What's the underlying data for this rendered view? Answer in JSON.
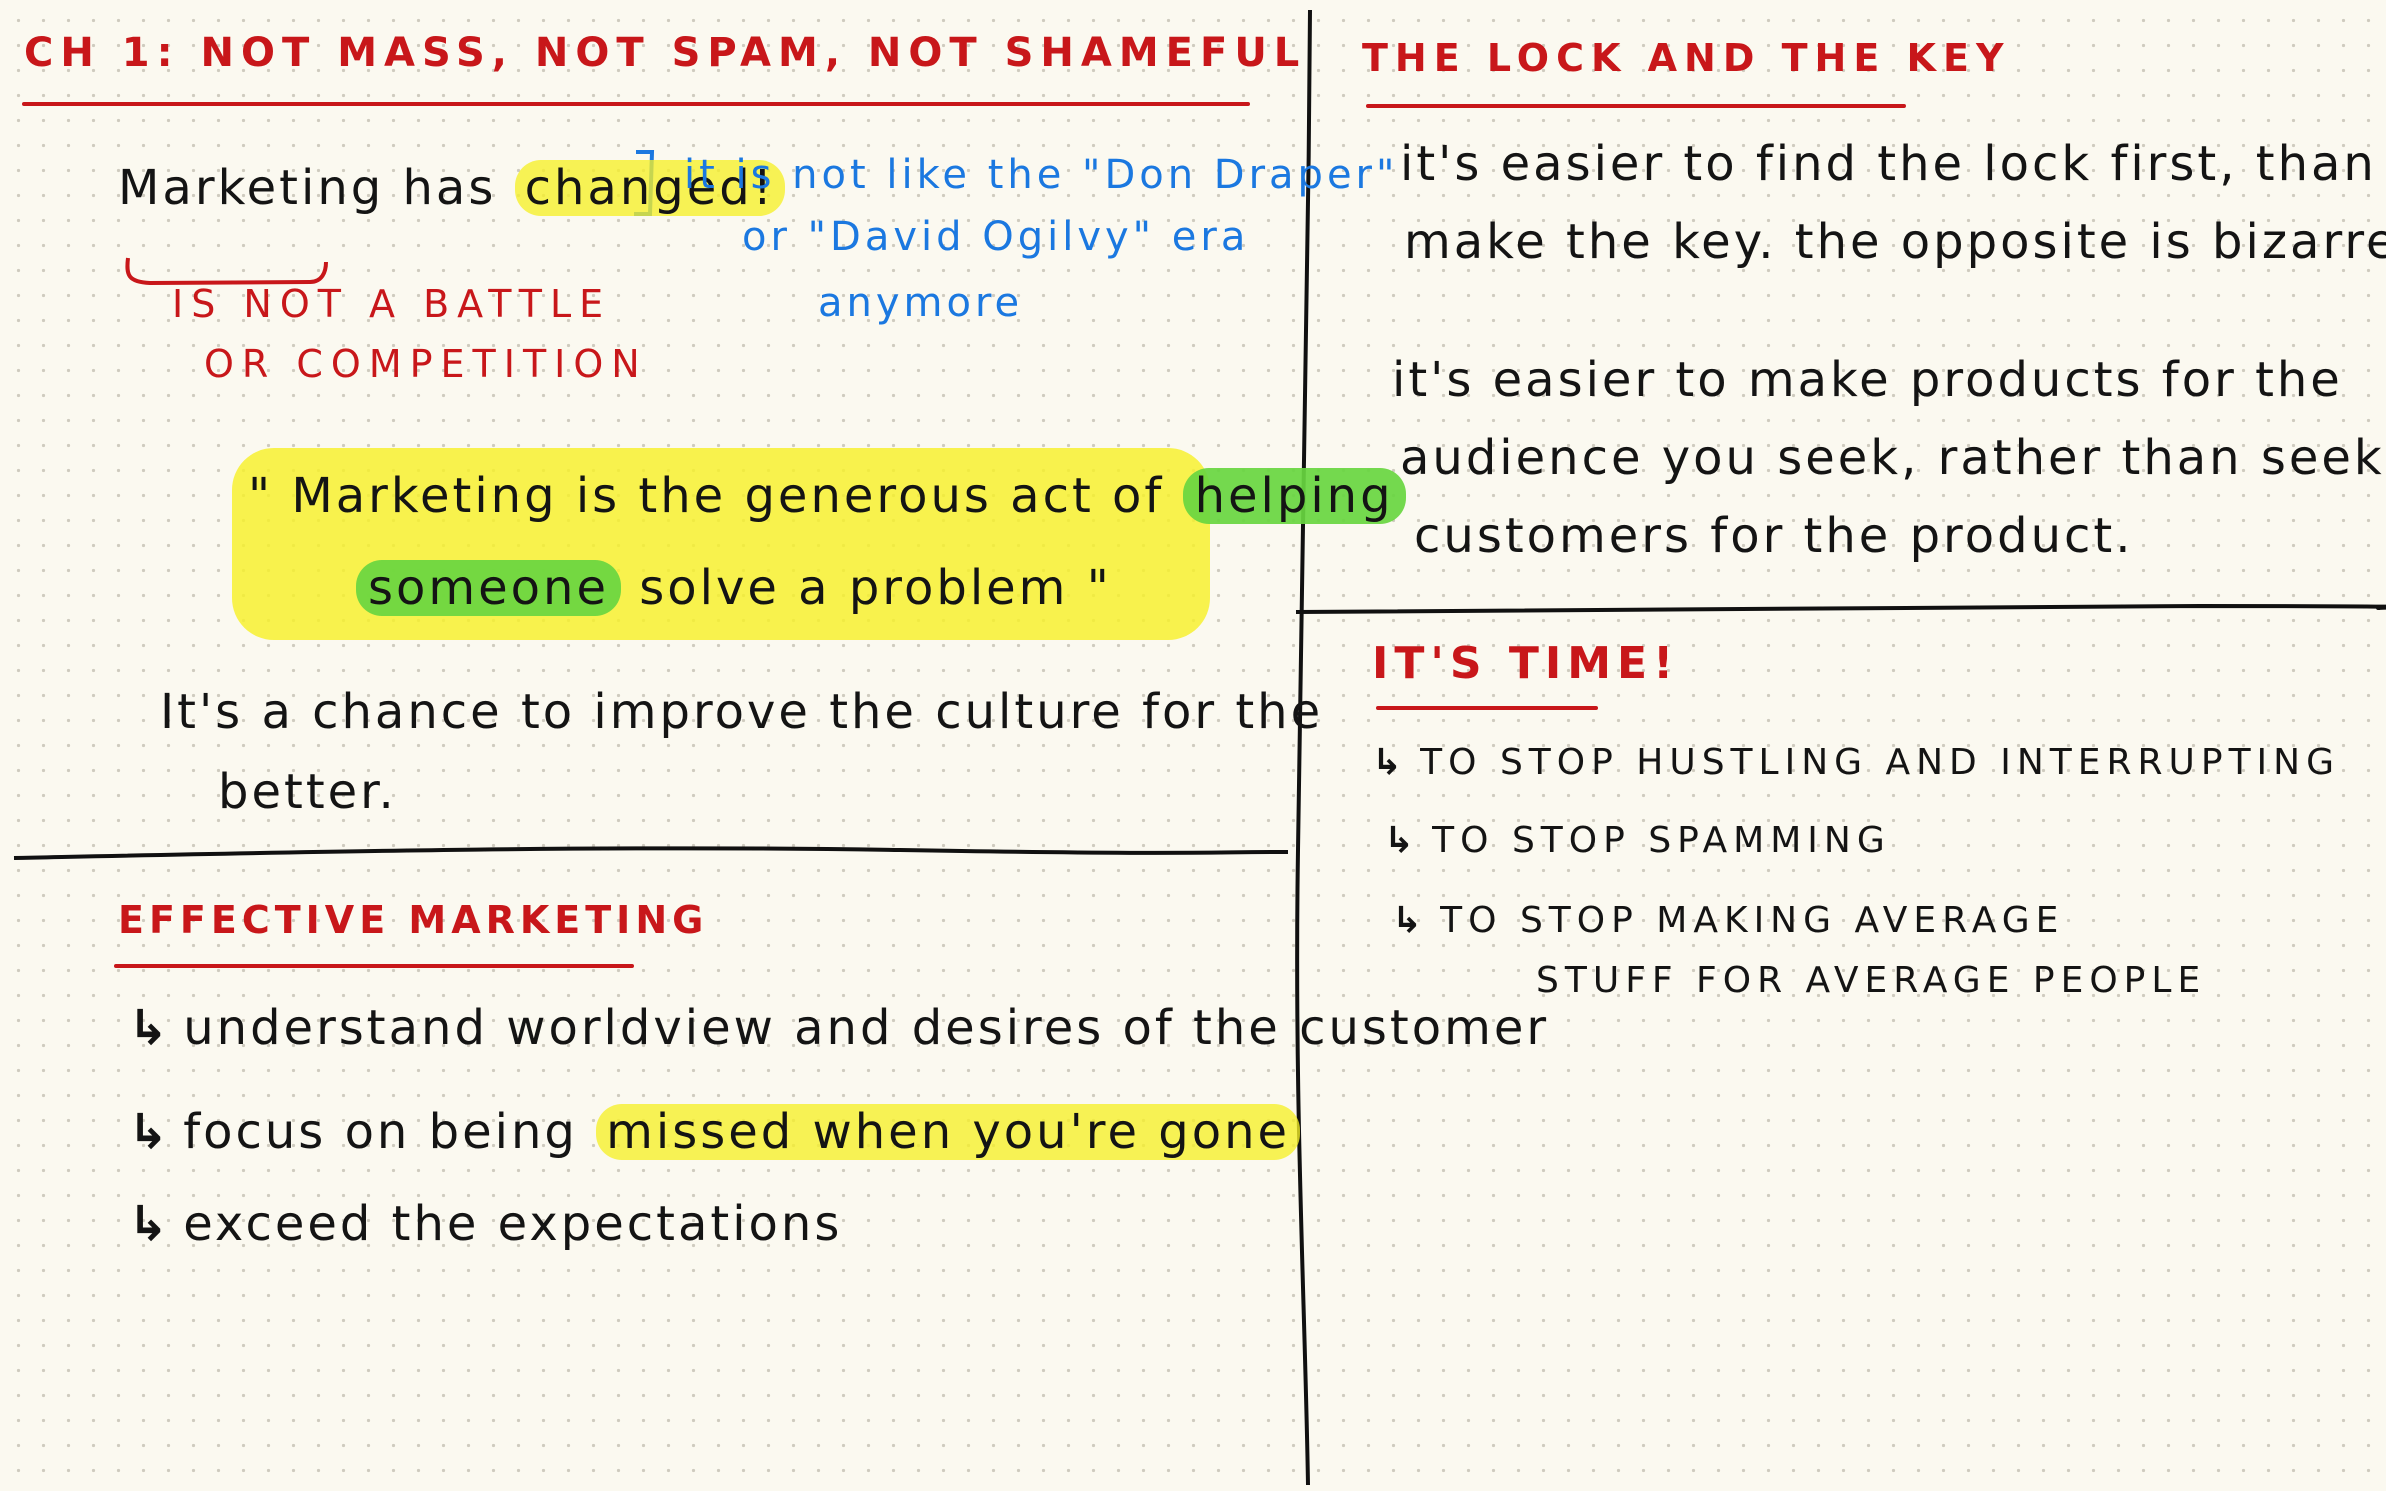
{
  "q1": {
    "title": "CH 1: NOT MASS, NOT SPAM, NOT SHAMEFUL",
    "changed": {
      "pre": "Marketing has",
      "highlight": "changed!",
      "note": "it is not like the \"Don Draper\"",
      "note2": "or \"David Ogilvy\" era",
      "note3": "anymore"
    },
    "battle_line1": "IS NOT A BATTLE",
    "battle_line2": "OR COMPETITION",
    "quote": {
      "open": "\"",
      "part1": "Marketing is the generous act of",
      "hl1": "helping",
      "hl2": "someone",
      "part2": "solve a problem",
      "close": "\""
    },
    "culture_line1": "It's a chance to improve the culture for the",
    "culture_line2": "better."
  },
  "q2": {
    "title": "THE LOCK AND THE KEY",
    "lines": [
      "it's easier to find the lock first, than",
      "make the key. the opposite is bizarre.",
      "it's easier to make products for the",
      "audience you seek, rather than seeking",
      "customers for the product."
    ]
  },
  "q3": {
    "title": "EFFECTIVE MARKETING",
    "item1": "understand worldview and desires of the customer",
    "item2_pre": "focus on being",
    "item2_hl": "missed when you're gone",
    "item3": "exceed the expectations",
    "arrow": "↳"
  },
  "q4": {
    "title": "IT'S TIME!",
    "items": [
      "TO STOP HUSTLING AND INTERRUPTING",
      "TO STOP SPAMMING",
      "TO STOP MAKING AVERAGE"
    ],
    "item3_cont": "STUFF FOR AVERAGE PEOPLE",
    "arrow": "↳"
  },
  "colors": {
    "ink": "#141414",
    "red": "#c8171a",
    "blue": "#1b78e0",
    "highlight_yellow": "#f6f028",
    "highlight_green": "#68d640",
    "paper": "#fbf9f0"
  }
}
